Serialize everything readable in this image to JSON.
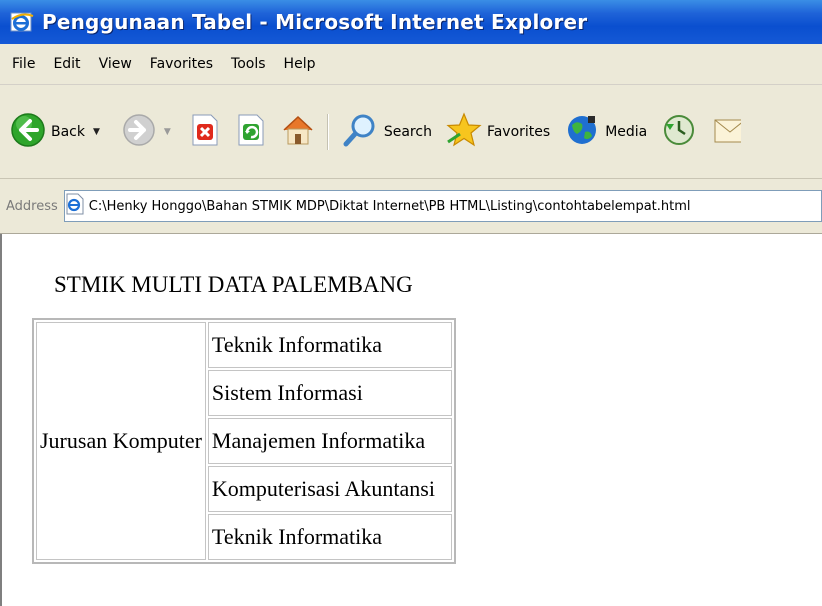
{
  "window": {
    "title": "Penggunaan Tabel - Microsoft Internet Explorer"
  },
  "menu": [
    "File",
    "Edit",
    "View",
    "Favorites",
    "Tools",
    "Help"
  ],
  "toolbar": {
    "back_label": "Back",
    "search_label": "Search",
    "favorites_label": "Favorites",
    "media_label": "Media"
  },
  "address": {
    "label": "Address",
    "value": "C:\\Henky Honggo\\Bahan STMIK MDP\\Diktat Internet\\PB HTML\\Listing\\contohtabelempat.html"
  },
  "page": {
    "heading": "STMIK MULTI DATA PALEMBANG",
    "table": {
      "row_header": "Jurusan Komputer",
      "rows": [
        "Teknik Informatika",
        "Sistem Informasi",
        "Manajemen Informatika",
        "Komputerisasi Akuntansi",
        "Teknik Informatika"
      ]
    }
  },
  "icons": {
    "title": "ie-logo-icon",
    "back": "back-arrow-icon",
    "forward": "forward-arrow-icon",
    "stop": "stop-icon",
    "refresh": "refresh-icon",
    "home": "home-icon",
    "search": "search-icon",
    "favorites": "favorites-star-icon",
    "media": "media-icon",
    "history": "history-icon",
    "mail": "mail-icon",
    "address_page": "page-icon"
  },
  "colors": {
    "titlebar": "#0a4fcf",
    "chrome": "#ece9d8",
    "back_green": "#2ea52b"
  }
}
